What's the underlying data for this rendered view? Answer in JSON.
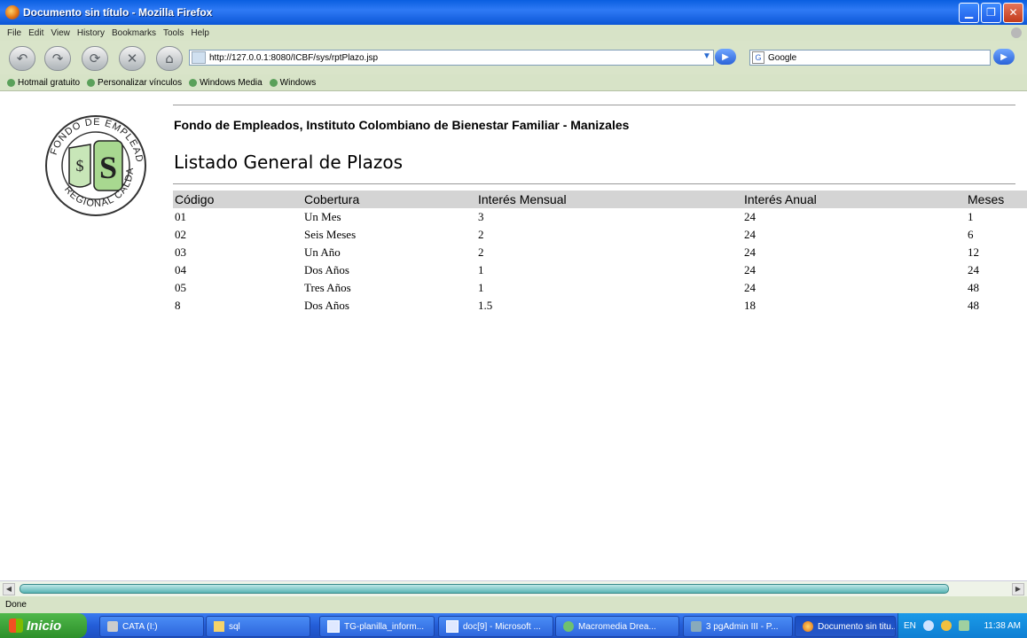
{
  "window": {
    "title": "Documento sin título - Mozilla Firefox"
  },
  "menu": [
    "File",
    "Edit",
    "View",
    "History",
    "Bookmarks",
    "Tools",
    "Help"
  ],
  "address": {
    "url": "http://127.0.0.1:8080/ICBF/sys/rptPlazo.jsp"
  },
  "search": {
    "engine": "Google"
  },
  "bookmarks": [
    "Hotmail gratuito",
    "Personalizar vínculos",
    "Windows Media",
    "Windows"
  ],
  "report": {
    "org": "Fondo de Empleados, Instituto Colombiano de Bienestar Familiar - Manizales",
    "title": "Listado General de Plazos",
    "columns": [
      "Código",
      "Cobertura",
      "Interés Mensual",
      "Interés Anual",
      "Meses"
    ],
    "rows": [
      [
        "01",
        "Un Mes",
        "3",
        "24",
        "1"
      ],
      [
        "02",
        "Seis Meses",
        "2",
        "24",
        "6"
      ],
      [
        "03",
        "Un Año",
        "2",
        "24",
        "12"
      ],
      [
        "04",
        "Dos Años",
        "1",
        "24",
        "24"
      ],
      [
        "05",
        "Tres Años",
        "1",
        "24",
        "48"
      ],
      [
        "8",
        "Dos Años",
        "1.5",
        "18",
        "48"
      ]
    ]
  },
  "logo": {
    "top_text": "FONDO DE EMPLEADOS ICBF",
    "bottom_text": "REGIONAL CALDAS",
    "badge_left": "$",
    "badge_right": "S"
  },
  "status": {
    "text": "Done"
  },
  "taskbar": {
    "start": "Inicio",
    "tasks": [
      "CATA (I:)",
      "sql",
      "TG-planilla_inform...",
      "doc[9] - Microsoft ...",
      "Macromedia Drea...",
      "3 pgAdmin III - P...",
      "Documento sin titu..."
    ],
    "lang": "EN",
    "clock": "11:38 AM"
  }
}
